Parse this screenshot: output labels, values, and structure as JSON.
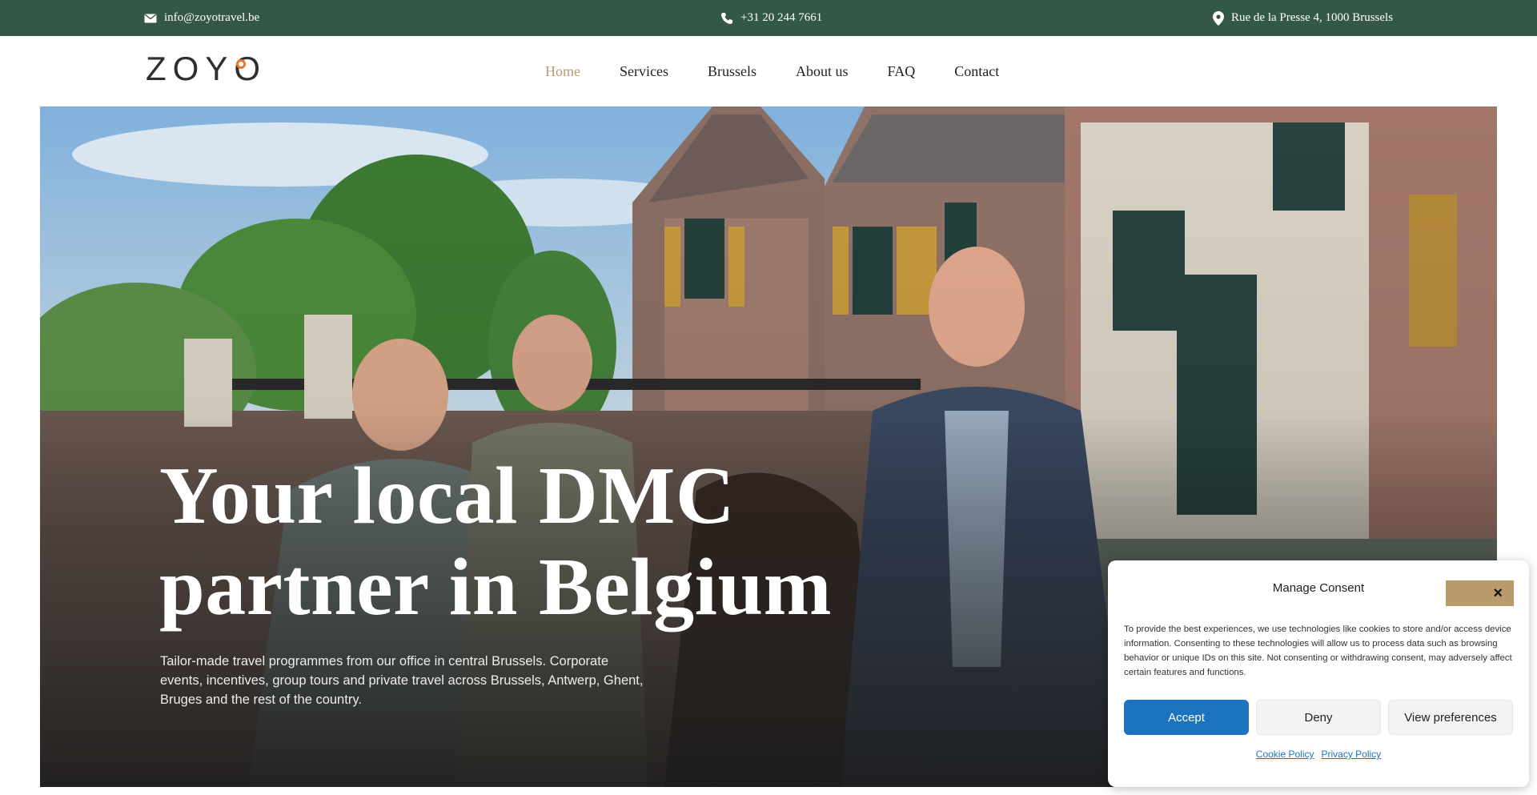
{
  "topbar": {
    "email": "info@zoyotravel.be",
    "phone": "+31 20 244 7661",
    "address": "Rue de la Presse 4, 1000 Brussels"
  },
  "header": {
    "logo_text": "ZOYO",
    "nav": [
      {
        "label": "Home",
        "active": true
      },
      {
        "label": "Services",
        "active": false
      },
      {
        "label": "Brussels",
        "active": false
      },
      {
        "label": "About us",
        "active": false
      },
      {
        "label": "FAQ",
        "active": false
      },
      {
        "label": "Contact",
        "active": false
      }
    ]
  },
  "hero": {
    "title_line1": "Your local DMC",
    "title_line2": "partner in Belgium",
    "subtitle": "Tailor-made travel programmes from our office in central Brussels. Corporate events, incentives, group tours and private travel across Brussels, Antwerp, Ghent, Bruges and the rest of the country."
  },
  "consent": {
    "title": "Manage Consent",
    "close_icon": "×",
    "text": "To provide the best experiences, we use technologies like cookies to store and/or access device information. Consenting to these technologies will allow us to process data such as browsing behavior or unique IDs on this site. Not consenting or withdrawing consent, may adversely affect certain features and functions.",
    "accept": "Accept",
    "deny": "Deny",
    "view_preferences": "View preferences",
    "cookie_policy": "Cookie Policy",
    "privacy_policy": "Privacy Policy"
  },
  "colors": {
    "topbar_bg": "#345846",
    "nav_active": "#b79c72",
    "accept_bg": "#1e73be",
    "close_bg": "#b99a6b"
  }
}
